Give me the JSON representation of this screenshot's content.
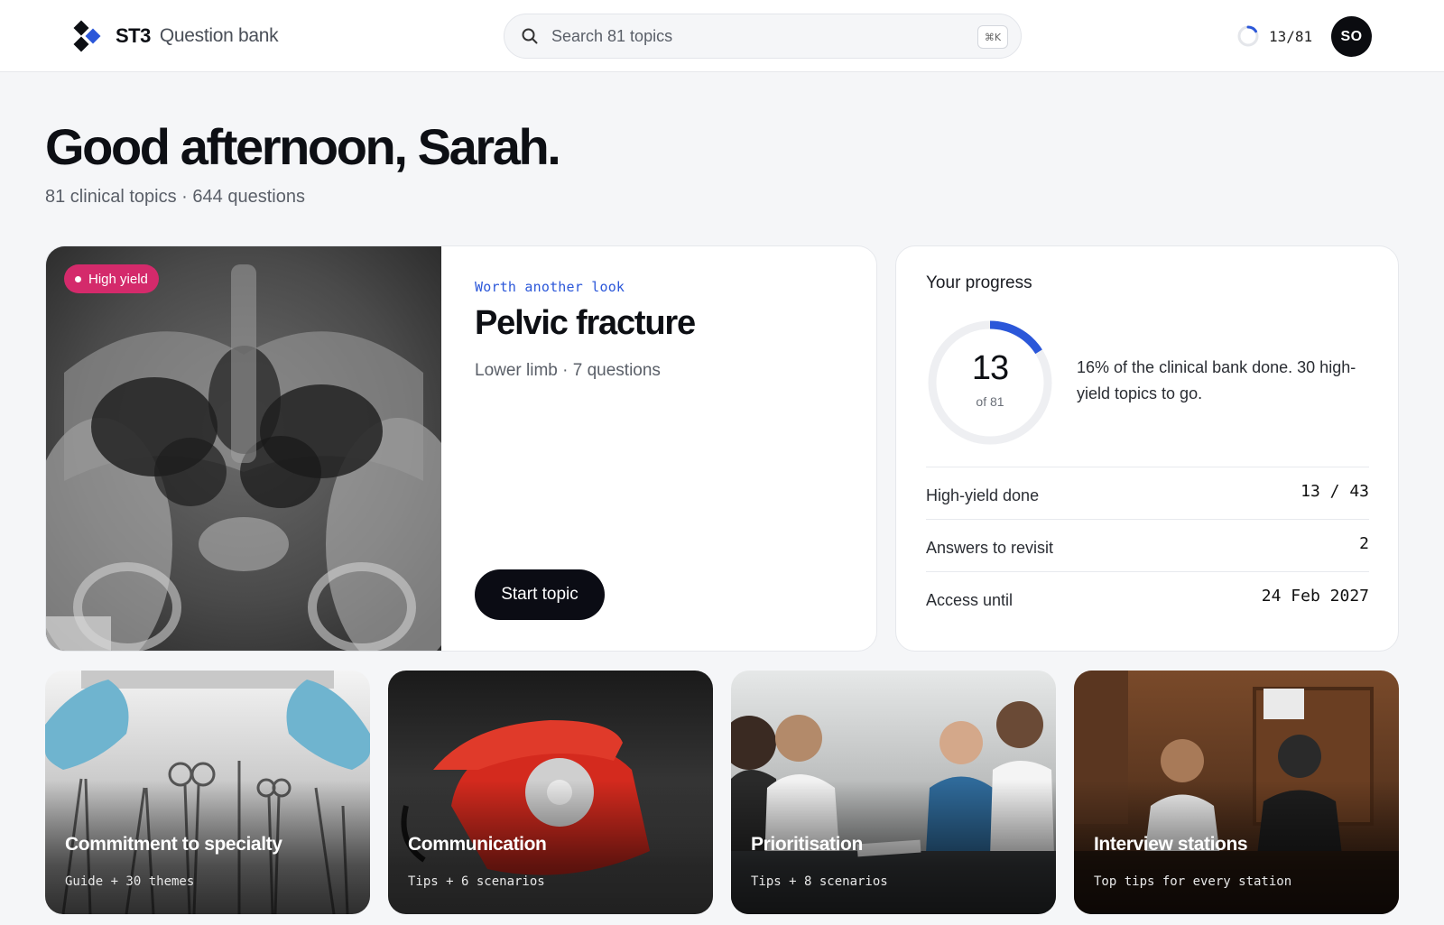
{
  "header": {
    "brand": "ST3",
    "product": "Question bank",
    "search_placeholder": "Search 81 topics",
    "search_shortcut": "⌘K",
    "progress_count": "13/81",
    "progress_fraction": 0.16,
    "avatar_initials": "SO"
  },
  "greeting": {
    "title": "Good afternoon, Sarah.",
    "subtitle": "81 clinical topics · 644 questions"
  },
  "featured": {
    "badge": "High yield",
    "kicker": "Worth another look",
    "title": "Pelvic fracture",
    "meta": "Lower limb · 7 questions",
    "button": "Start topic"
  },
  "progress": {
    "title": "Your progress",
    "done": "13",
    "of_total": "of 81",
    "fraction": 0.16,
    "summary": "16% of the clinical bank done. 30 high-yield topics to go.",
    "rows": [
      {
        "label": "High-yield done",
        "value": "13 / 43"
      },
      {
        "label": "Answers to revisit",
        "value": "2"
      },
      {
        "label": "Access until",
        "value": "24 Feb 2027"
      }
    ]
  },
  "tiles": [
    {
      "title": "Commitment to specialty",
      "subtitle": "Guide + 30 themes",
      "image": "surgical-instruments"
    },
    {
      "title": "Communication",
      "subtitle": "Tips + 6 scenarios",
      "image": "red-telephone"
    },
    {
      "title": "Prioritisation",
      "subtitle": "Tips + 8 scenarios",
      "image": "doctors-meeting"
    },
    {
      "title": "Interview stations",
      "subtitle": "Top tips for every station",
      "image": "interview-room"
    }
  ],
  "colors": {
    "accent": "#2b57d9",
    "badge": "#d42a6b",
    "dark": "#0b0c14"
  }
}
